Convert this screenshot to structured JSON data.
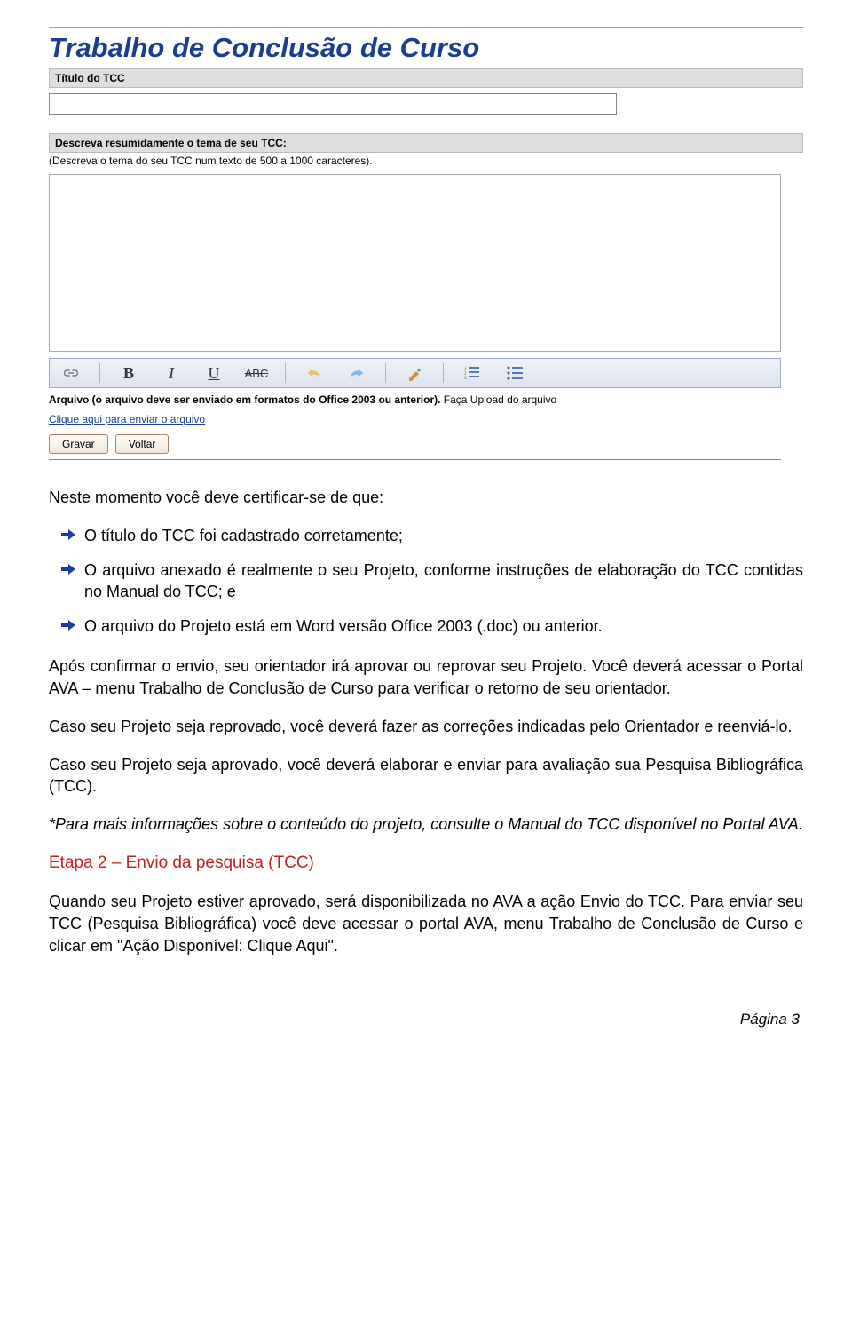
{
  "form": {
    "heading": "Trabalho de Conclusão de Curso",
    "titulo_label": "Título do TCC",
    "desc_label": "Descreva resumidamente o tema de seu TCC:",
    "desc_help": "(Descreva o tema do seu TCC num texto de 500 a 1000 caracteres).",
    "arquivo_bold": "Arquivo (o arquivo deve ser enviado em formatos do Office 2003 ou anterior).",
    "arquivo_rest": " Faça Upload do arquivo",
    "enviar_link": "Clique aqui para enviar o arquivo",
    "btn_gravar": "Gravar",
    "btn_voltar": "Voltar",
    "toolbar": {
      "bold": "B",
      "italic": "I",
      "underline": "U",
      "strike": "ABC"
    }
  },
  "text": {
    "intro": "Neste momento você deve certificar-se de que:",
    "b1": "O título do TCC foi cadastrado corretamente;",
    "b2": "O arquivo anexado é realmente o seu Projeto, conforme instruções de elaboração do TCC contidas no Manual do TCC; e",
    "b3": "O arquivo do Projeto está em Word versão Office 2003 (.doc) ou anterior.",
    "p1": "Após confirmar o envio, seu orientador irá aprovar ou reprovar seu Projeto. Você deverá acessar o Portal AVA – menu Trabalho de Conclusão de Curso para verificar o retorno de seu orientador.",
    "p2": "Caso seu Projeto seja reprovado, você deverá fazer as correções indicadas pelo Orientador e reenviá-lo.",
    "p3": "Caso seu Projeto seja aprovado, você deverá elaborar e enviar para avaliação sua Pesquisa Bibliográfica (TCC).",
    "note": "*Para mais informações sobre o conteúdo do projeto, consulte o Manual do TCC disponível no Portal AVA.",
    "etapa": "Etapa 2 – Envio da pesquisa (TCC)",
    "p4": "Quando seu Projeto estiver aprovado, será disponibilizada no AVA a ação Envio do TCC. Para enviar seu TCC (Pesquisa Bibliográfica) você deve acessar o portal AVA, menu Trabalho de Conclusão de Curso e clicar em \"Ação Disponível: Clique Aqui\".",
    "footer": "Página 3"
  }
}
